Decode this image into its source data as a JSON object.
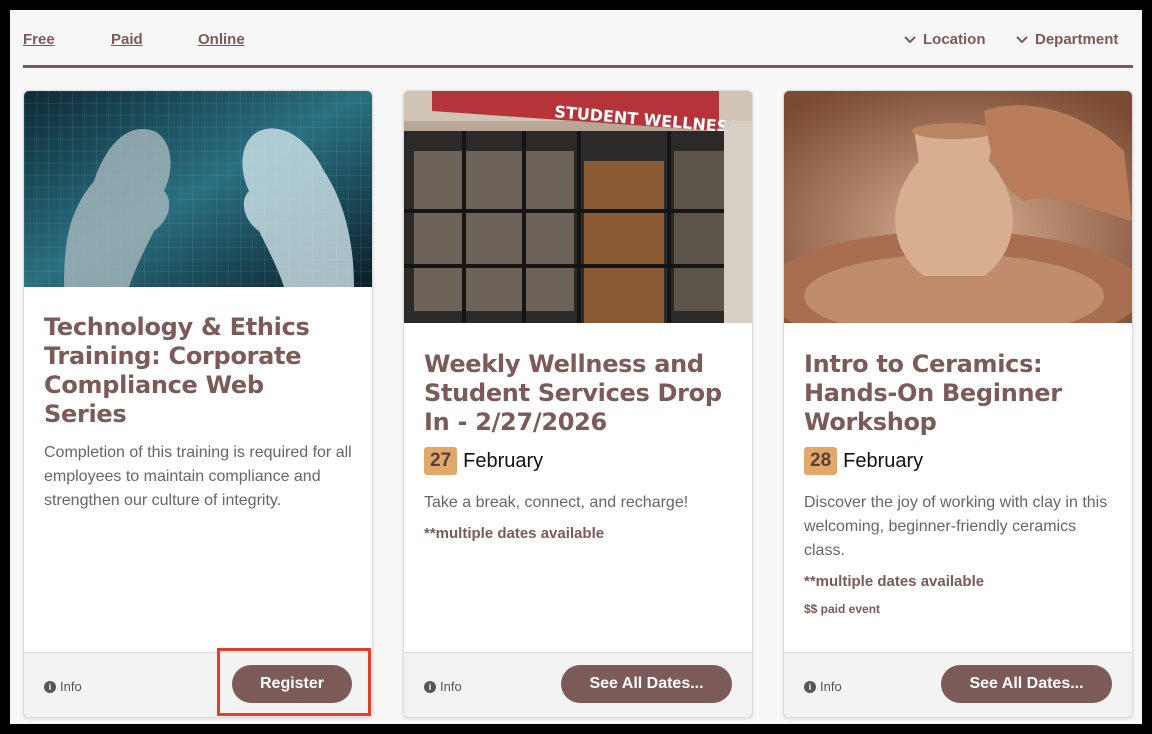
{
  "filters": {
    "links": [
      "Free",
      "Paid",
      "Online"
    ],
    "dropdowns": [
      "Location",
      "Department"
    ]
  },
  "cards": [
    {
      "image": "ai-faces-image",
      "title": "Technology & Ethics Training: Corporate Compliance Web Series",
      "description": "Completion of this training is required for all employees to maintain compliance and strengthen our culture of integrity.",
      "info_label": "Info",
      "button_label": "Register"
    },
    {
      "image": "student-wellness-center-image",
      "title": "Weekly Wellness and Student Services Drop In - 2/27/2026",
      "date_day": "27",
      "date_month": "February",
      "description": "Take a break, connect, and recharge!",
      "multiple_dates": "**multiple dates available",
      "info_label": "Info",
      "button_label": "See All Dates..."
    },
    {
      "image": "pottery-wheel-image",
      "title": "Intro to Ceramics: Hands-On Beginner Workshop",
      "date_day": "28",
      "date_month": "February",
      "description": "Discover the joy of working with clay in this welcoming, beginner-friendly ceramics class.",
      "multiple_dates": "**multiple dates available",
      "paid_label": "$$ paid event",
      "info_label": "Info",
      "button_label": "See All Dates..."
    }
  ],
  "colors": {
    "brand": "#7b5a57",
    "date_badge": "#e0a86a",
    "highlight": "#e0402b"
  }
}
